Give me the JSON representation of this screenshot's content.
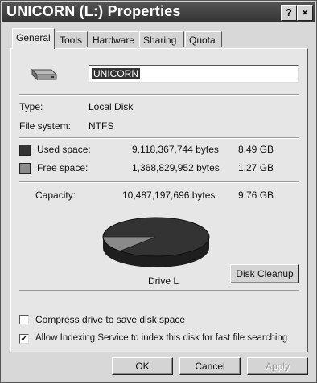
{
  "window": {
    "title": "UNICORN (L:) Properties",
    "help_label": "?",
    "close_label": "×"
  },
  "tabs": [
    {
      "label": "General",
      "active": true
    },
    {
      "label": "Tools"
    },
    {
      "label": "Hardware"
    },
    {
      "label": "Sharing"
    },
    {
      "label": "Quota"
    }
  ],
  "drive": {
    "icon": "hard-drive-icon",
    "name": "UNICORN"
  },
  "info": {
    "type_label": "Type:",
    "type_value": "Local Disk",
    "fs_label": "File system:",
    "fs_value": "NTFS"
  },
  "space": {
    "used_label": "Used space:",
    "used_bytes": "9,118,367,744 bytes",
    "used_gb": "8.49 GB",
    "used_color": "#333333",
    "free_label": "Free space:",
    "free_bytes": "1,368,829,952 bytes",
    "free_gb": "1.27 GB",
    "free_color": "#8a8a8a",
    "capacity_label": "Capacity:",
    "capacity_bytes": "10,487,197,696 bytes",
    "capacity_gb": "9.76 GB",
    "used_fraction": 0.8695
  },
  "pie_label": "Drive L",
  "disk_cleanup_label": "Disk Cleanup",
  "options": {
    "compress_label": "Compress drive to save disk space",
    "compress_checked": false,
    "index_label": "Allow Indexing Service to index this disk for fast file searching",
    "index_checked": true,
    "check_mark": "✓"
  },
  "buttons": {
    "ok": "OK",
    "cancel": "Cancel",
    "apply": "Apply"
  }
}
